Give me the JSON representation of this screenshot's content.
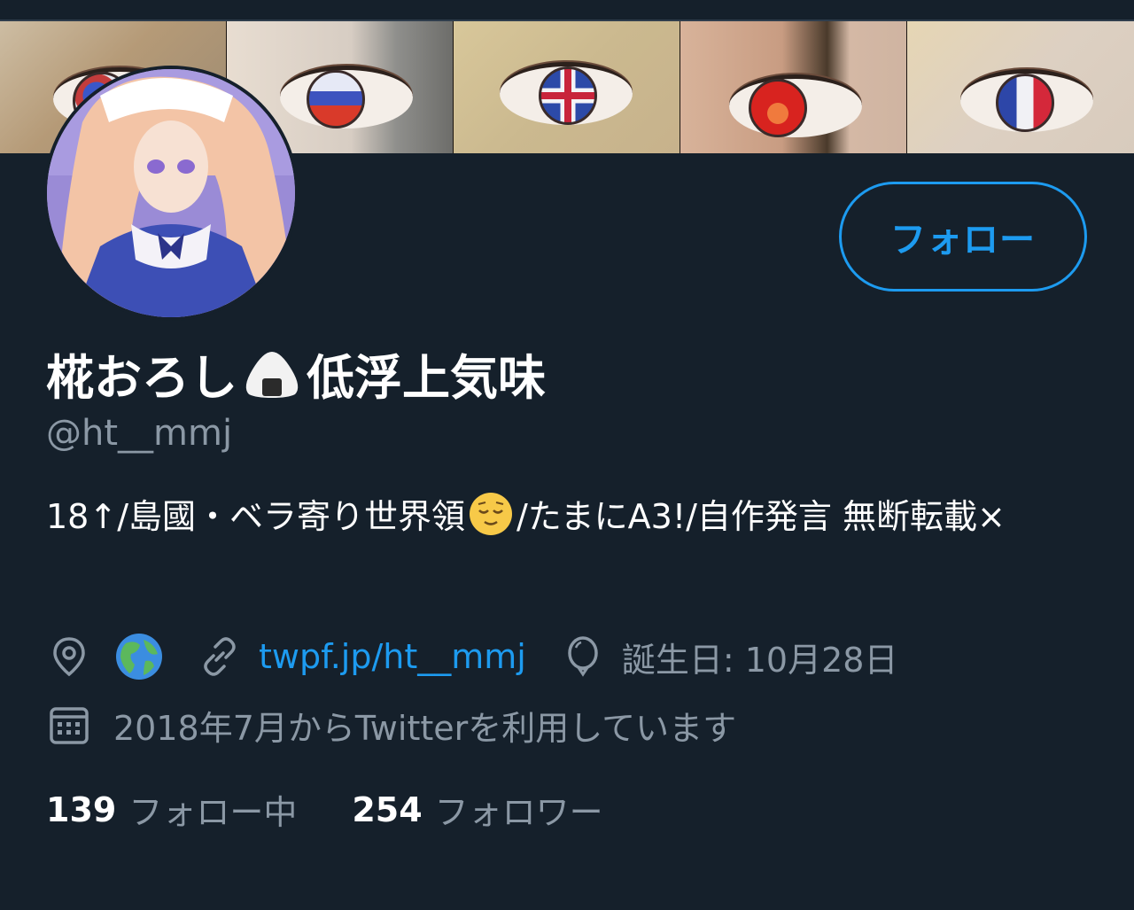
{
  "profile": {
    "display_name_part1": "椛おろし",
    "display_name_emoji": "onigiri-emoji",
    "display_name_part2": "低浮上気味",
    "handle": "@ht__mmj",
    "follow_button_label": "フォロー",
    "bio_part1": "18↑/島國・ベラ寄り世界領",
    "bio_emoji": "relieved-face-emoji",
    "bio_part2": "/たまにA3!/自作発言 無断転載×"
  },
  "meta": {
    "location_icon": "location-pin-icon",
    "location_emoji": "globe-americas-emoji",
    "link_icon": "link-icon",
    "link_text": "twpf.jp/ht__mmj",
    "birthday_icon": "balloon-icon",
    "birthday_text": "誕生日: 10月28日",
    "joined_icon": "calendar-icon",
    "joined_text": "2018年7月からTwitterを利用しています"
  },
  "stats": {
    "following_count": "139",
    "following_label": "フォロー中",
    "followers_count": "254",
    "followers_label": "フォロワー"
  },
  "colors": {
    "background": "#15202b",
    "accent": "#1d9bf0",
    "secondary_text": "#8b98a5",
    "primary_text": "#ffffff"
  }
}
